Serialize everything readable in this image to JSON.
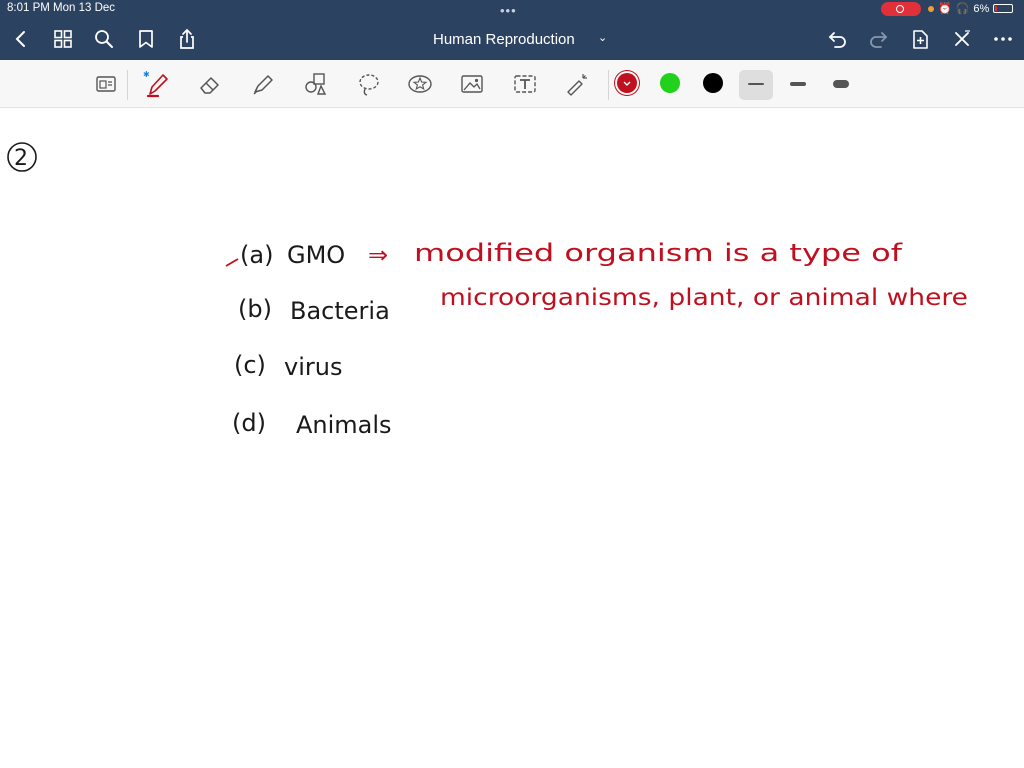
{
  "status_bar": {
    "time_date": "8:01 PM   Mon 13 Dec",
    "battery": "6%"
  },
  "header": {
    "title": "Human Reproduction"
  },
  "toolbar": {
    "tools": [
      "page-thumbnail",
      "pen",
      "eraser",
      "highlighter",
      "shapes",
      "lasso",
      "stickers",
      "image",
      "text",
      "laser-pointer"
    ],
    "active_tool": "pen",
    "colors": [
      "#c0101f",
      "#21d11b",
      "#000000"
    ],
    "selected_color": "#c0101f",
    "stroke_widths": [
      "thin",
      "medium",
      "thick"
    ],
    "selected_stroke": "thin"
  },
  "note": {
    "question_number": "2",
    "options": [
      {
        "label": "(a)",
        "text": "GMO"
      },
      {
        "label": "(b)",
        "text": "Bacteria"
      },
      {
        "label": "(c)",
        "text": "virus"
      },
      {
        "label": "(d)",
        "text": "Animals"
      }
    ],
    "arrow": "⇒",
    "answer_line1": "modified organism is a type of",
    "answer_line2": "microorganisms, plant, or animal where",
    "ink_black": "#1a1a1a",
    "ink_red": "#c0101f"
  }
}
